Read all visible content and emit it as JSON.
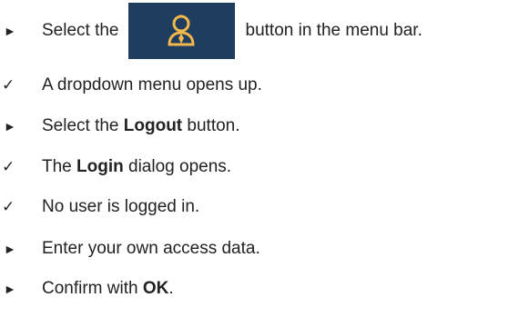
{
  "steps": [
    {
      "marker": "►",
      "type": "action",
      "before": "Select the ",
      "after": " button in the menu bar.",
      "icon": "user-icon"
    },
    {
      "marker": "✓",
      "type": "result",
      "text": "A dropdown menu opens up."
    },
    {
      "marker": "►",
      "type": "action",
      "before": "Select the ",
      "bold": "Logout",
      "after": " button."
    },
    {
      "marker": "✓",
      "type": "result",
      "before": "The ",
      "bold": "Login",
      "after": " dialog opens."
    },
    {
      "marker": "✓",
      "type": "result",
      "text": "No user is logged in."
    },
    {
      "marker": "►",
      "type": "action",
      "text": "Enter your own access data."
    },
    {
      "marker": "►",
      "type": "action",
      "before": "Confirm with ",
      "bold": "OK",
      "after": "."
    }
  ],
  "colors": {
    "button_background": "#1f3d5e",
    "icon_color": "#f2b84b",
    "text": "#222222"
  }
}
